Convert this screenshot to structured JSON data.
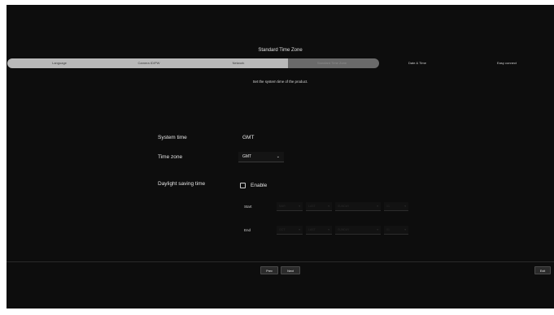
{
  "header": {
    "title": "Standard Time Zone"
  },
  "wizard": {
    "steps": [
      {
        "label": "Language",
        "state": "done"
      },
      {
        "label": "Camera ID/PW",
        "state": "done"
      },
      {
        "label": "Network",
        "state": "done"
      },
      {
        "label": "Standard Time Zone",
        "state": "current"
      },
      {
        "label": "Date & Time",
        "state": "future"
      },
      {
        "label": "Easy connect",
        "state": "future"
      }
    ]
  },
  "main": {
    "subtitle": "Set the system time of the product.",
    "system_time": {
      "label": "System time",
      "value": "GMT"
    },
    "time_zone": {
      "label": "Time zone",
      "value": "GMT"
    },
    "daylight_saving": {
      "label": "Daylight saving time",
      "enable_label": "Enable",
      "enabled": false,
      "start": {
        "label": "Start",
        "values": [
          "MAR",
          "LAST",
          "SUNDAY",
          "01"
        ]
      },
      "end": {
        "label": "End",
        "values": [
          "OCT",
          "LAST",
          "SUNDAY",
          "01"
        ]
      }
    }
  },
  "footer": {
    "prev": "Prev",
    "next": "Next",
    "exit": "Exit"
  },
  "colors": {
    "background": "#0d0d0d",
    "step_done": "#b9b9b9",
    "step_current": "#6a6a6a"
  }
}
